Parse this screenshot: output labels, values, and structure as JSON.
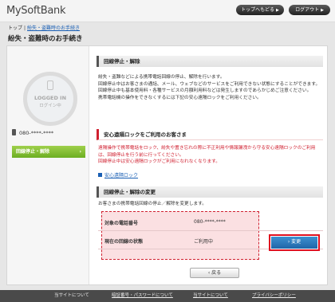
{
  "header": {
    "logo": "MySoftBank",
    "top_button": "トップへもどる",
    "logout_button": "ログアウト"
  },
  "breadcrumb": {
    "home": "トップ",
    "current": "紛失・盗難時のお手続き"
  },
  "page_title": "紛失・盗難時のお手続き",
  "sidebar": {
    "avatar_text": "LOGGED IN",
    "avatar_subtext": "ログイン中",
    "phone_number": "080-****-****",
    "nav_button": "回線停止・解除"
  },
  "section1": {
    "title": "回線停止・解除",
    "paragraphs": [
      "紛失・盗難などによる携帯電話回線の停止、解除を行います。",
      "回線停止中はお客さまの通話、メール、ウェブなどのサービスをご利用できない状態にすることができます。",
      "回線停止中も基本使用料・各種サービスの月額利用料などは発生しますのであらかじめご注意ください。",
      "携帯電話機の操作をできなくするには下記の安心遠隔ロックをご利用ください。"
    ]
  },
  "section2": {
    "title": "安心遠隔ロックをご利用のお客さま",
    "warning": "遠隔操作で携帯電話をロック、紛失や置き忘れの際に不正利用や情報漏洩から守る安心遠隔ロックのご利用は、回線停止を行う前に行ってください。",
    "warning2": "回線停止中は安心遠隔ロックがご利用になれなくなります。",
    "link": "安心遠隔ロック"
  },
  "section3": {
    "title": "回線停止・解除の変更",
    "desc": "お客さまの携帯電話回線の停止／解除を変更します。",
    "rows": [
      {
        "label": "対象の電話番号",
        "value": "080-****-****"
      },
      {
        "label": "現在の回線の状態",
        "value": "ご利用中"
      }
    ],
    "change_button": "変更",
    "back_button": "戻る"
  },
  "footer": {
    "about": "当サイトについて",
    "items": [
      "暗証番号・パスワードについて",
      "当サイトについて",
      "プライバシーポリシー"
    ]
  },
  "colors": {
    "accent_red": "#d02030",
    "green_button": "#7dba2f",
    "blue_button": "#2a74b8",
    "link_blue": "#1a5fb4"
  }
}
